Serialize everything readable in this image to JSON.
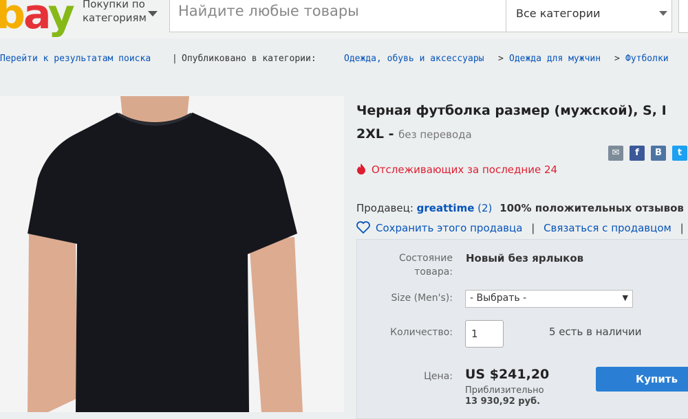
{
  "header": {
    "logo": {
      "b": "b",
      "a": "a",
      "y": "y"
    },
    "shop_by_category": [
      "Покупки по",
      "категориям"
    ],
    "search_placeholder": "Найдите любые товары",
    "category_select": "Все категории"
  },
  "breadcrumb": {
    "back": "Перейти к результатам поиска",
    "separator": "|",
    "published_in": "Опубликовано в категории:",
    "path": [
      "Одежда, обувь и аксессуары",
      "Одежда для мужчин",
      "Футболки"
    ],
    "arrow": ">"
  },
  "listing": {
    "title_line1": "Черная футболка размер (мужской), S, I",
    "title_line2": "2XL - ",
    "title_note": "без перевода",
    "share_icons": {
      "email": "✉",
      "facebook": "f",
      "vk": "B",
      "twitter": "t"
    },
    "watchers": "Отслеживающих за последние 24"
  },
  "seller": {
    "label": "Продавец:",
    "name": "greattime",
    "score": "(2)",
    "feedback": "100% положительных отзывов",
    "save": "Сохранить этого продавца",
    "sep": "|",
    "contact": "Связаться с продавцом",
    "sep2": "|"
  },
  "purchase": {
    "condition_label_1": "Состояние",
    "condition_label_2": "товара:",
    "condition_value": "Новый без ярлыков",
    "size_label": "Size (Men's):",
    "size_value": "- Выбрать -",
    "qty_label": "Количество:",
    "qty_value": "1",
    "stock": "5 есть в наличии",
    "price_label": "Цена:",
    "price": "US $241,20",
    "approx_1": "Приблизительно",
    "approx_2": "13 930,92 руб.",
    "buy_label": "Купить"
  },
  "colors": {
    "link": "#0654ba",
    "watch_red": "#dd1e31",
    "buy_button": "#2a7fd4",
    "facebook": "#3b5998",
    "vk": "#4c75a3",
    "twitter": "#1da1f2",
    "email": "#7d8b99"
  }
}
